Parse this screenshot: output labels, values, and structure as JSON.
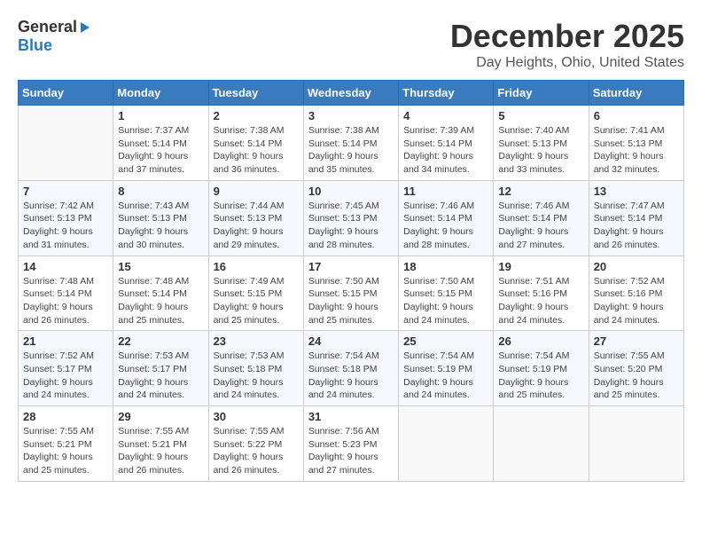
{
  "logo": {
    "general": "General",
    "blue": "Blue"
  },
  "title": "December 2025",
  "subtitle": "Day Heights, Ohio, United States",
  "weekdays": [
    "Sunday",
    "Monday",
    "Tuesday",
    "Wednesday",
    "Thursday",
    "Friday",
    "Saturday"
  ],
  "weeks": [
    [
      {
        "day": "",
        "sunrise": "",
        "sunset": "",
        "daylight": ""
      },
      {
        "day": "1",
        "sunrise": "Sunrise: 7:37 AM",
        "sunset": "Sunset: 5:14 PM",
        "daylight": "Daylight: 9 hours and 37 minutes."
      },
      {
        "day": "2",
        "sunrise": "Sunrise: 7:38 AM",
        "sunset": "Sunset: 5:14 PM",
        "daylight": "Daylight: 9 hours and 36 minutes."
      },
      {
        "day": "3",
        "sunrise": "Sunrise: 7:38 AM",
        "sunset": "Sunset: 5:14 PM",
        "daylight": "Daylight: 9 hours and 35 minutes."
      },
      {
        "day": "4",
        "sunrise": "Sunrise: 7:39 AM",
        "sunset": "Sunset: 5:14 PM",
        "daylight": "Daylight: 9 hours and 34 minutes."
      },
      {
        "day": "5",
        "sunrise": "Sunrise: 7:40 AM",
        "sunset": "Sunset: 5:13 PM",
        "daylight": "Daylight: 9 hours and 33 minutes."
      },
      {
        "day": "6",
        "sunrise": "Sunrise: 7:41 AM",
        "sunset": "Sunset: 5:13 PM",
        "daylight": "Daylight: 9 hours and 32 minutes."
      }
    ],
    [
      {
        "day": "7",
        "sunrise": "Sunrise: 7:42 AM",
        "sunset": "Sunset: 5:13 PM",
        "daylight": "Daylight: 9 hours and 31 minutes."
      },
      {
        "day": "8",
        "sunrise": "Sunrise: 7:43 AM",
        "sunset": "Sunset: 5:13 PM",
        "daylight": "Daylight: 9 hours and 30 minutes."
      },
      {
        "day": "9",
        "sunrise": "Sunrise: 7:44 AM",
        "sunset": "Sunset: 5:13 PM",
        "daylight": "Daylight: 9 hours and 29 minutes."
      },
      {
        "day": "10",
        "sunrise": "Sunrise: 7:45 AM",
        "sunset": "Sunset: 5:13 PM",
        "daylight": "Daylight: 9 hours and 28 minutes."
      },
      {
        "day": "11",
        "sunrise": "Sunrise: 7:46 AM",
        "sunset": "Sunset: 5:14 PM",
        "daylight": "Daylight: 9 hours and 28 minutes."
      },
      {
        "day": "12",
        "sunrise": "Sunrise: 7:46 AM",
        "sunset": "Sunset: 5:14 PM",
        "daylight": "Daylight: 9 hours and 27 minutes."
      },
      {
        "day": "13",
        "sunrise": "Sunrise: 7:47 AM",
        "sunset": "Sunset: 5:14 PM",
        "daylight": "Daylight: 9 hours and 26 minutes."
      }
    ],
    [
      {
        "day": "14",
        "sunrise": "Sunrise: 7:48 AM",
        "sunset": "Sunset: 5:14 PM",
        "daylight": "Daylight: 9 hours and 26 minutes."
      },
      {
        "day": "15",
        "sunrise": "Sunrise: 7:48 AM",
        "sunset": "Sunset: 5:14 PM",
        "daylight": "Daylight: 9 hours and 25 minutes."
      },
      {
        "day": "16",
        "sunrise": "Sunrise: 7:49 AM",
        "sunset": "Sunset: 5:15 PM",
        "daylight": "Daylight: 9 hours and 25 minutes."
      },
      {
        "day": "17",
        "sunrise": "Sunrise: 7:50 AM",
        "sunset": "Sunset: 5:15 PM",
        "daylight": "Daylight: 9 hours and 25 minutes."
      },
      {
        "day": "18",
        "sunrise": "Sunrise: 7:50 AM",
        "sunset": "Sunset: 5:15 PM",
        "daylight": "Daylight: 9 hours and 24 minutes."
      },
      {
        "day": "19",
        "sunrise": "Sunrise: 7:51 AM",
        "sunset": "Sunset: 5:16 PM",
        "daylight": "Daylight: 9 hours and 24 minutes."
      },
      {
        "day": "20",
        "sunrise": "Sunrise: 7:52 AM",
        "sunset": "Sunset: 5:16 PM",
        "daylight": "Daylight: 9 hours and 24 minutes."
      }
    ],
    [
      {
        "day": "21",
        "sunrise": "Sunrise: 7:52 AM",
        "sunset": "Sunset: 5:17 PM",
        "daylight": "Daylight: 9 hours and 24 minutes."
      },
      {
        "day": "22",
        "sunrise": "Sunrise: 7:53 AM",
        "sunset": "Sunset: 5:17 PM",
        "daylight": "Daylight: 9 hours and 24 minutes."
      },
      {
        "day": "23",
        "sunrise": "Sunrise: 7:53 AM",
        "sunset": "Sunset: 5:18 PM",
        "daylight": "Daylight: 9 hours and 24 minutes."
      },
      {
        "day": "24",
        "sunrise": "Sunrise: 7:54 AM",
        "sunset": "Sunset: 5:18 PM",
        "daylight": "Daylight: 9 hours and 24 minutes."
      },
      {
        "day": "25",
        "sunrise": "Sunrise: 7:54 AM",
        "sunset": "Sunset: 5:19 PM",
        "daylight": "Daylight: 9 hours and 24 minutes."
      },
      {
        "day": "26",
        "sunrise": "Sunrise: 7:54 AM",
        "sunset": "Sunset: 5:19 PM",
        "daylight": "Daylight: 9 hours and 25 minutes."
      },
      {
        "day": "27",
        "sunrise": "Sunrise: 7:55 AM",
        "sunset": "Sunset: 5:20 PM",
        "daylight": "Daylight: 9 hours and 25 minutes."
      }
    ],
    [
      {
        "day": "28",
        "sunrise": "Sunrise: 7:55 AM",
        "sunset": "Sunset: 5:21 PM",
        "daylight": "Daylight: 9 hours and 25 minutes."
      },
      {
        "day": "29",
        "sunrise": "Sunrise: 7:55 AM",
        "sunset": "Sunset: 5:21 PM",
        "daylight": "Daylight: 9 hours and 26 minutes."
      },
      {
        "day": "30",
        "sunrise": "Sunrise: 7:55 AM",
        "sunset": "Sunset: 5:22 PM",
        "daylight": "Daylight: 9 hours and 26 minutes."
      },
      {
        "day": "31",
        "sunrise": "Sunrise: 7:56 AM",
        "sunset": "Sunset: 5:23 PM",
        "daylight": "Daylight: 9 hours and 27 minutes."
      },
      {
        "day": "",
        "sunrise": "",
        "sunset": "",
        "daylight": ""
      },
      {
        "day": "",
        "sunrise": "",
        "sunset": "",
        "daylight": ""
      },
      {
        "day": "",
        "sunrise": "",
        "sunset": "",
        "daylight": ""
      }
    ]
  ]
}
